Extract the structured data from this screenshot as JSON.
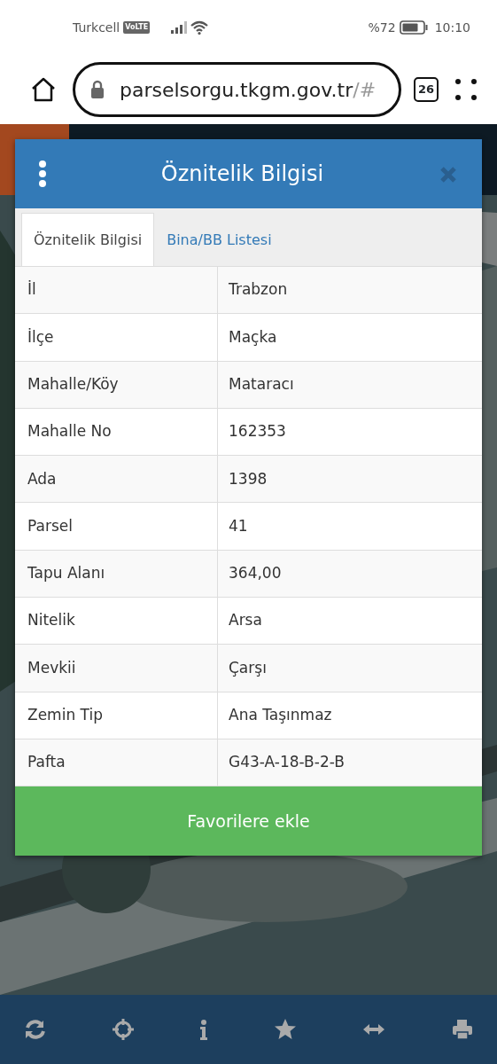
{
  "status_bar": {
    "carrier": "Turkcell",
    "volte": "VoLTE",
    "battery": "%72",
    "time": "10:10"
  },
  "browser": {
    "url": "parselsorgu.tkgm.gov.tr",
    "url_tail": "/#",
    "tab_count": "26"
  },
  "modal": {
    "title": "Öznitelik Bilgisi",
    "tabs": [
      {
        "label": "Öznitelik Bilgisi",
        "selected": true
      },
      {
        "label": "Bina/BB Listesi",
        "selected": false
      }
    ],
    "rows": [
      {
        "label": "İl",
        "value": "Trabzon"
      },
      {
        "label": "İlçe",
        "value": "Maçka"
      },
      {
        "label": "Mahalle/Köy",
        "value": "Mataracı"
      },
      {
        "label": "Mahalle No",
        "value": "162353"
      },
      {
        "label": "Ada",
        "value": "1398"
      },
      {
        "label": "Parsel",
        "value": "41"
      },
      {
        "label": "Tapu Alanı",
        "value": "364,00"
      },
      {
        "label": "Nitelik",
        "value": "Arsa"
      },
      {
        "label": "Mevkii",
        "value": "Çarşı"
      },
      {
        "label": "Zemin Tip",
        "value": "Ana Taşınmaz"
      },
      {
        "label": "Pafta",
        "value": "G43-A-18-B-2-B"
      }
    ],
    "button": "Favorilere ekle"
  },
  "toolbar": [
    {
      "kind": "refresh"
    },
    {
      "kind": "locate"
    },
    {
      "kind": "info"
    },
    {
      "kind": "star"
    },
    {
      "kind": "measure"
    },
    {
      "kind": "print"
    }
  ]
}
